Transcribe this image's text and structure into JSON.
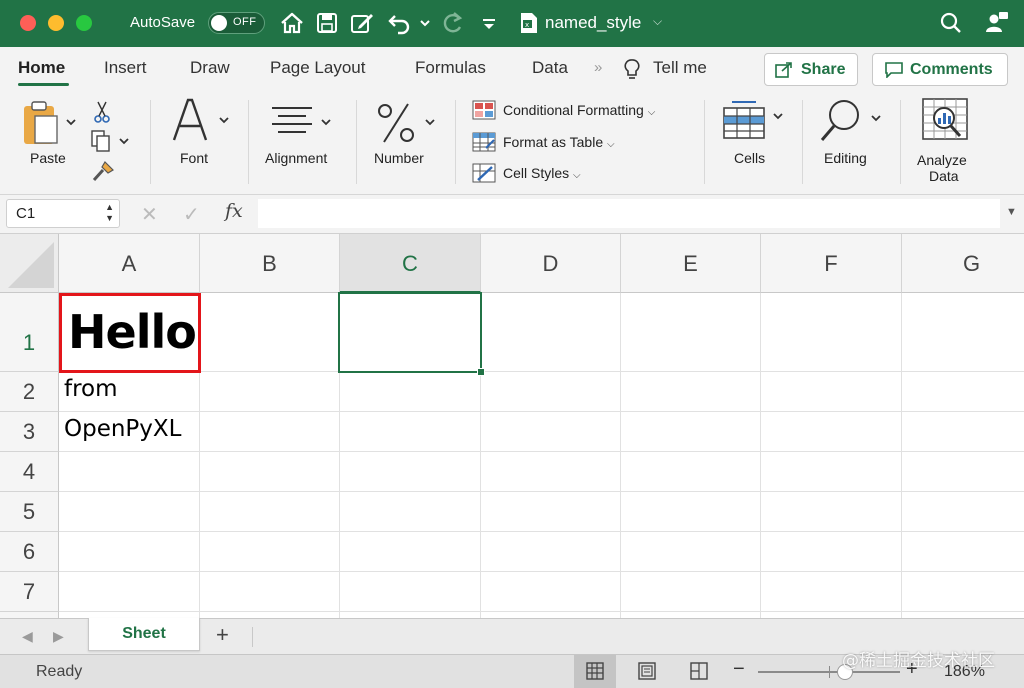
{
  "titlebar": {
    "autosave_label": "AutoSave",
    "autosave_state": "OFF",
    "document_title": "named_style",
    "icons": [
      "home-icon",
      "save-icon",
      "edit-icon",
      "undo-icon",
      "redo-icon",
      "customize-icon",
      "search-icon",
      "share-person-icon"
    ]
  },
  "tabs": {
    "items": [
      "Home",
      "Insert",
      "Draw",
      "Page Layout",
      "Formulas",
      "Data"
    ],
    "tell_me": "Tell me",
    "share": "Share",
    "comments": "Comments"
  },
  "ribbon": {
    "paste": "Paste",
    "font": "Font",
    "alignment": "Alignment",
    "number": "Number",
    "conditional_formatting": "Conditional Formatting",
    "format_as_table": "Format as Table",
    "cell_styles": "Cell Styles",
    "cells": "Cells",
    "editing": "Editing",
    "analyze_data_1": "Analyze",
    "analyze_data_2": "Data"
  },
  "formula_bar": {
    "name_box": "C1",
    "fx": "fx",
    "value": ""
  },
  "grid": {
    "columns": [
      "A",
      "B",
      "C",
      "D",
      "E",
      "F",
      "G"
    ],
    "rows": [
      "1",
      "2",
      "3",
      "4",
      "5",
      "6",
      "7"
    ],
    "selected_column": "C",
    "selected_row": "1",
    "cells": {
      "A1": "Hello",
      "A2": "from",
      "A3": "OpenPyXL"
    }
  },
  "sheets": {
    "tabs": [
      "Sheet"
    ],
    "active": "Sheet"
  },
  "status": {
    "text": "Ready",
    "zoom": "186%"
  },
  "watermark": "@稀土掘金技术社区",
  "colors": {
    "accent": "#217346",
    "highlight_border": "#e3151a"
  }
}
